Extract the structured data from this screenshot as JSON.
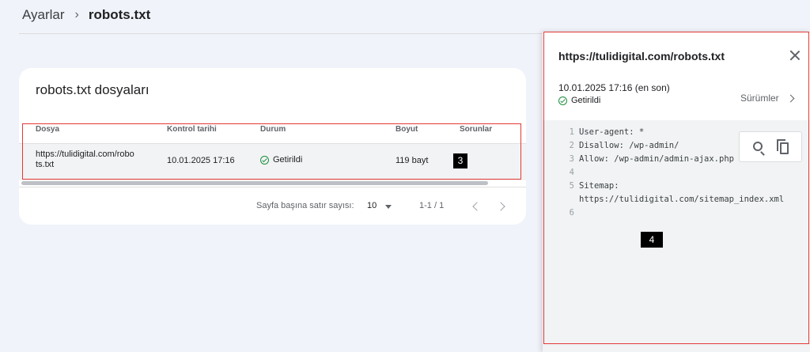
{
  "breadcrumb": {
    "root": "Ayarlar",
    "separator": "›",
    "current": "robots.txt"
  },
  "card": {
    "title": "robots.txt dosyaları",
    "columns": [
      "Dosya",
      "Kontrol tarihi",
      "Durum",
      "Boyut",
      "Sorunlar"
    ],
    "rows": [
      {
        "file_line1": "https://tulidigital.com/robo",
        "file_line2": "ts.txt",
        "date": "10.01.2025 17:16",
        "status": "Getirildi",
        "size": "119 bayt",
        "issues": ""
      }
    ],
    "badge": "3"
  },
  "pagination": {
    "rows_label": "Sayfa başına satır sayısı:",
    "rows_value": "10",
    "range": "1-1 / 1"
  },
  "panel": {
    "title": "https://tulidigital.com/robots.txt",
    "date": "10.01.2025 17:16 (en son)",
    "status": "Getirildi",
    "versions_label": "Sürümler",
    "badge": "4",
    "code_lines": [
      {
        "n": "1",
        "text": "User-agent: *"
      },
      {
        "n": "2",
        "text": "Disallow: /wp-admin/"
      },
      {
        "n": "3",
        "text": "Allow: /wp-admin/admin-ajax.php"
      },
      {
        "n": "4",
        "text": ""
      },
      {
        "n": "5",
        "text": "Sitemap:"
      },
      {
        "n": "",
        "text": "https://tulidigital.com/sitemap_index.xml"
      },
      {
        "n": "6",
        "text": ""
      }
    ]
  },
  "colors": {
    "accent_red": "#e53935",
    "success_green": "#1e8e3e",
    "background": "#f0f3f9"
  },
  "icons": [
    "chevron-right-icon",
    "check-circle-icon",
    "caret-down-icon",
    "chevron-left-icon",
    "close-icon",
    "search-icon",
    "copy-icon"
  ]
}
